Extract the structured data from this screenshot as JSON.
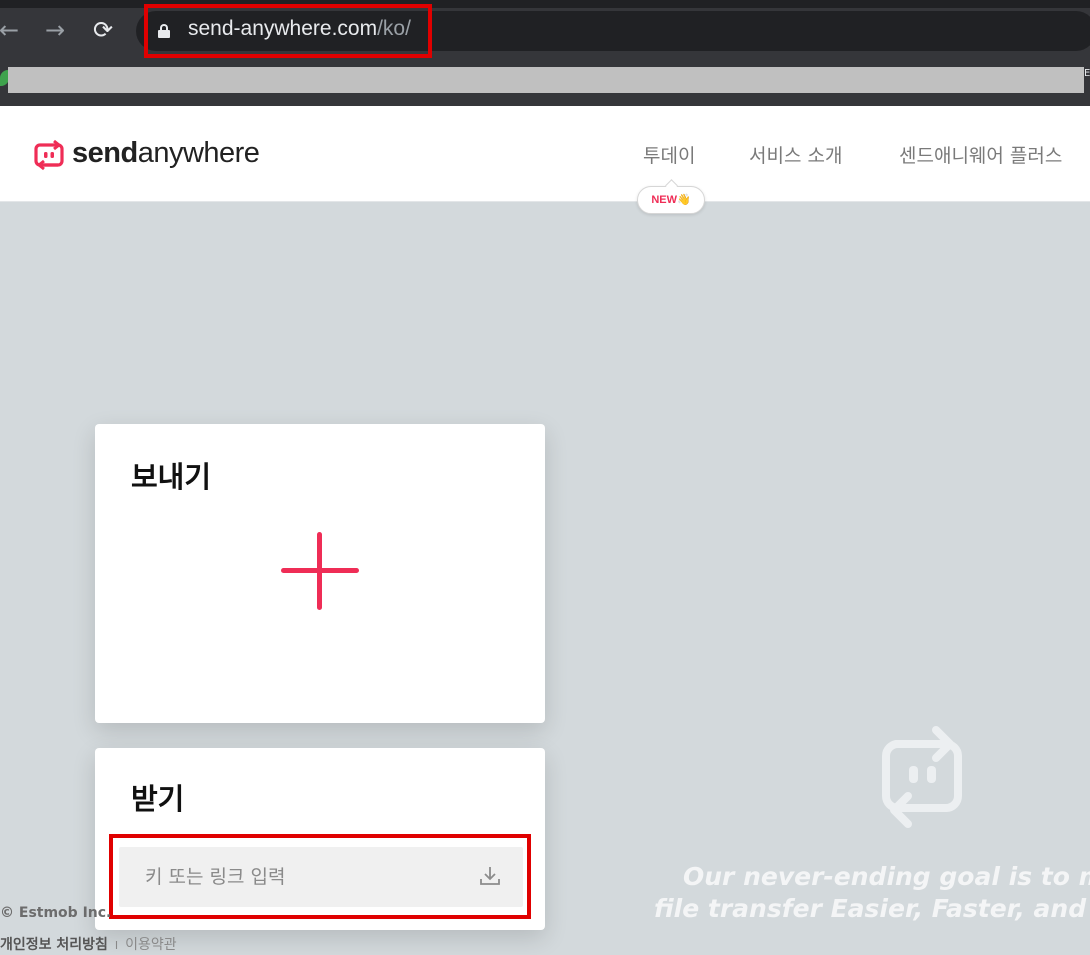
{
  "browser": {
    "url_host": "send-anywhere.com",
    "url_path": "/ko/",
    "bookmark_overflow": "E"
  },
  "header": {
    "logo_text_bold": "send",
    "logo_text_light": "anywhere",
    "menu": [
      {
        "label": "투데이"
      },
      {
        "label": "서비스 소개"
      },
      {
        "label": "센드애니웨어 플러스"
      }
    ],
    "new_badge": "NEW",
    "new_badge_emoji": "👋"
  },
  "send_card": {
    "title": "보내기"
  },
  "receive_card": {
    "title": "받기",
    "placeholder": "키 또는 링크 입력",
    "value": ""
  },
  "tagline": {
    "line1": "Our never-ending goal is to m",
    "line2": "file transfer Easier, Faster, and"
  },
  "footer": {
    "copyright": "© Estmob Inc.",
    "privacy": "개인정보 처리방침",
    "separator": "I",
    "terms": "이용약관"
  },
  "colors": {
    "brand": "#ef2d56",
    "background": "#d3d9dc",
    "highlight": "#e00000"
  }
}
